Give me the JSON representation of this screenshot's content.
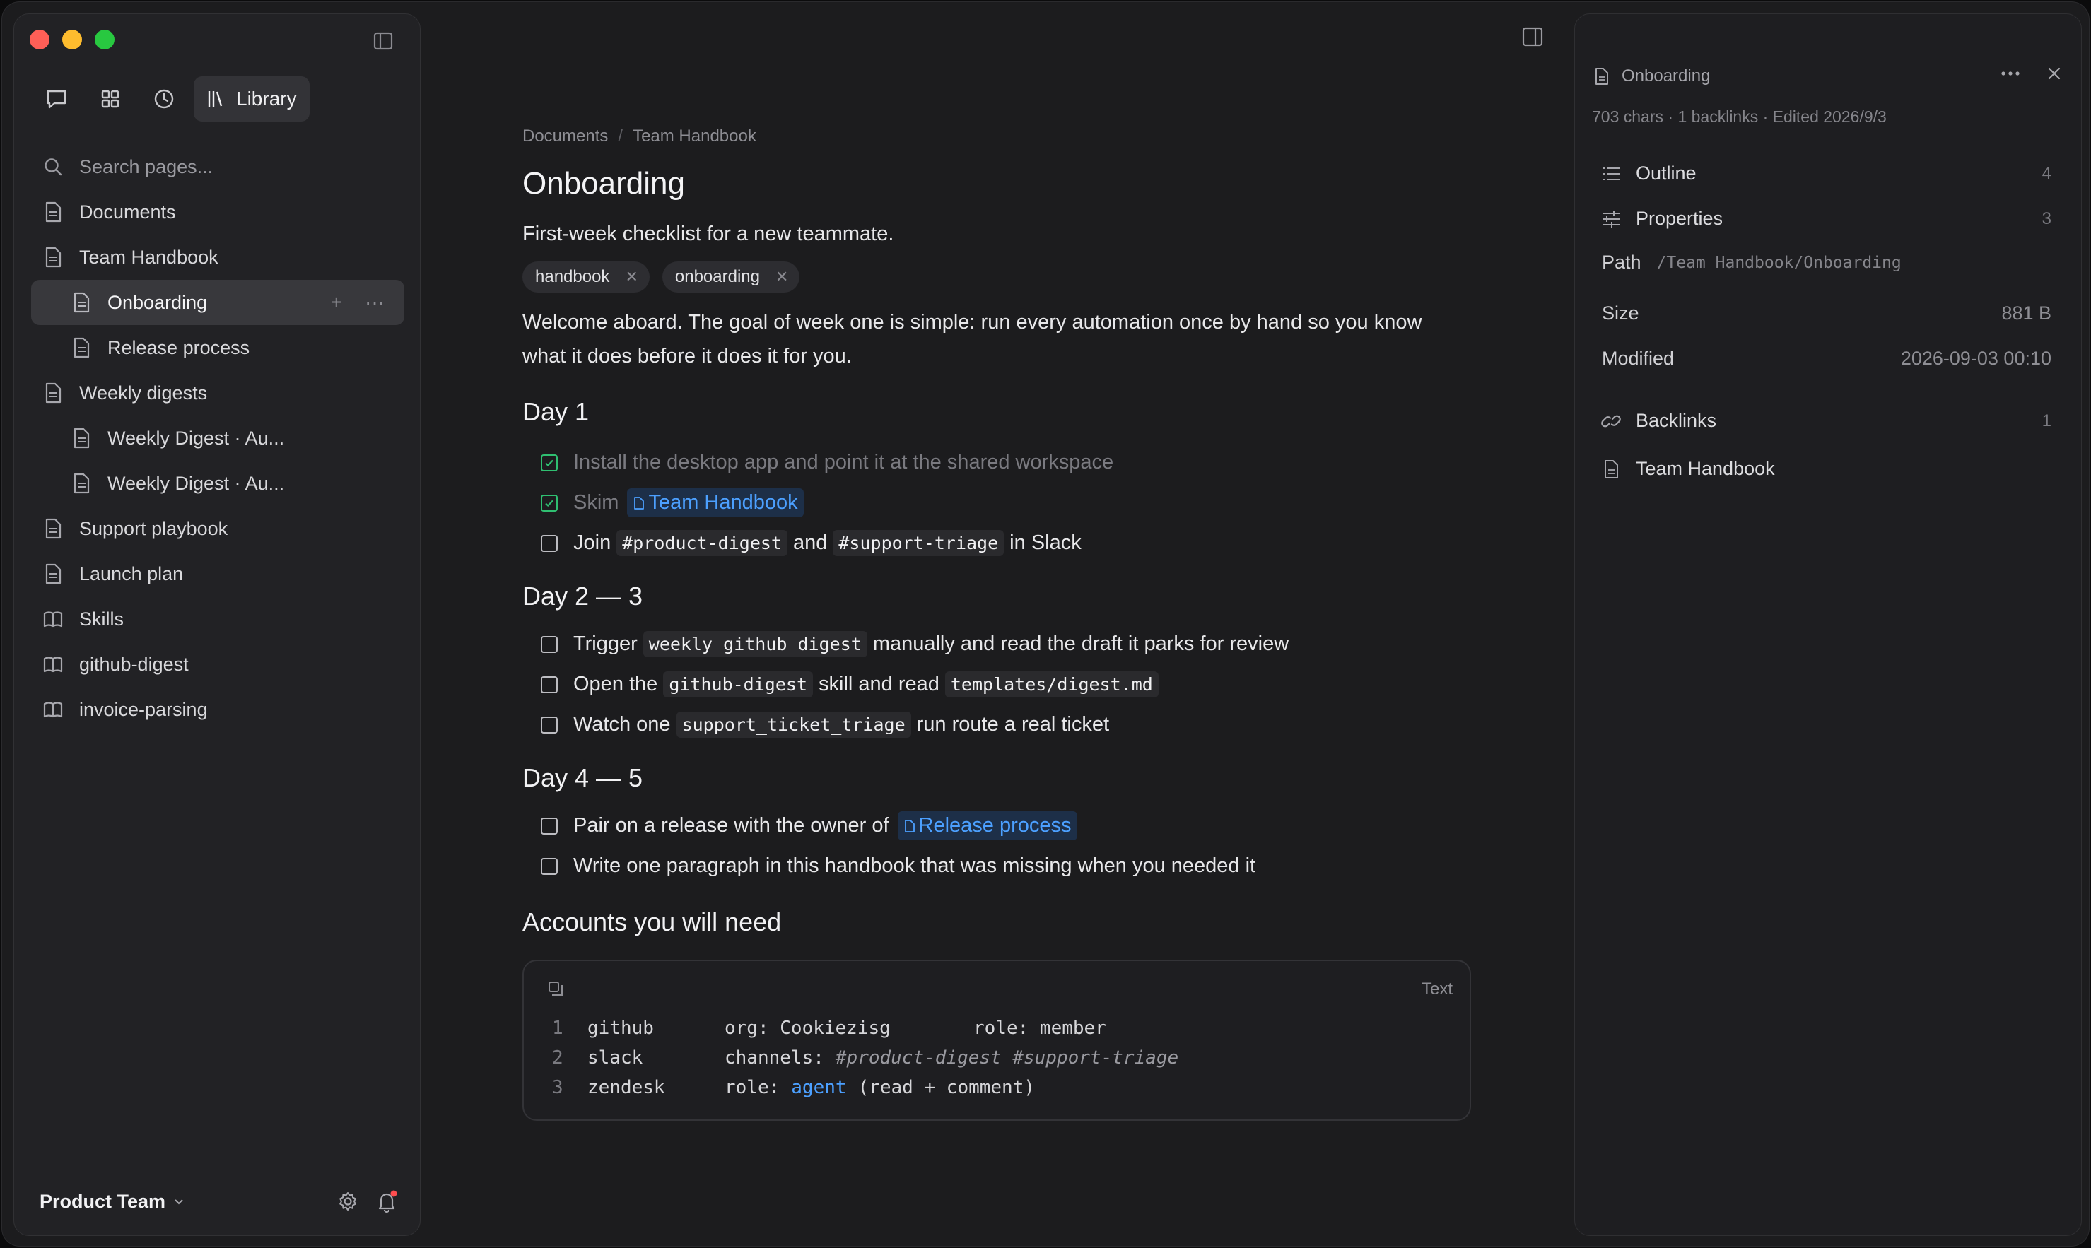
{
  "sidebar": {
    "library_label": "Library",
    "search_placeholder": "Search pages...",
    "items": [
      {
        "label": "Documents"
      },
      {
        "label": "Team Handbook"
      },
      {
        "label": "Onboarding"
      },
      {
        "label": "Release process"
      },
      {
        "label": "Weekly digests"
      },
      {
        "label": "Weekly Digest · Au..."
      },
      {
        "label": "Weekly Digest · Au..."
      },
      {
        "label": "Support playbook"
      },
      {
        "label": "Launch plan"
      },
      {
        "label": "Skills"
      },
      {
        "label": "github-digest"
      },
      {
        "label": "invoice-parsing"
      }
    ],
    "workspace": "Product Team",
    "row_actions": {
      "add": "+",
      "more": "···"
    }
  },
  "doc": {
    "breadcrumb": [
      "Documents",
      "/",
      "Team Handbook"
    ],
    "title": "Onboarding",
    "description": "First-week checklist for a new teammate.",
    "tags": [
      "handbook",
      "onboarding"
    ],
    "intro": "Welcome aboard. The goal of week one is simple: run every automation once by hand so you know what it does before it does it for you.",
    "day1": {
      "heading": "Day 1",
      "t1": "Install the desktop app and point it at the shared workspace",
      "t2_pre": "Skim",
      "t2_link": "Team Handbook",
      "t3_pre": "Join",
      "t3_code1": "#product-digest",
      "t3_mid": "and",
      "t3_code2": "#support-triage",
      "t3_post": "in Slack"
    },
    "day2": {
      "heading": "Day 2 — 3",
      "t1_pre": "Trigger",
      "t1_code": "weekly_github_digest",
      "t1_post": "manually and read the draft it parks for review",
      "t2_pre": "Open the",
      "t2_code1": "github-digest",
      "t2_mid": "skill and read",
      "t2_code2": "templates/digest.md",
      "t3_pre": "Watch one",
      "t3_code": "support_ticket_triage",
      "t3_post": "run route a real ticket"
    },
    "day4": {
      "heading": "Day 4 — 5",
      "t1_pre": "Pair on a release with the owner of",
      "t1_link": "Release process",
      "t2": "Write one paragraph in this handbook that was missing when you needed it"
    },
    "accounts": {
      "heading": "Accounts you will need",
      "lang": "Text",
      "lines": [
        {
          "n": "1",
          "a": "github",
          "b": "org: Cookiezisg",
          "c": "role: member"
        },
        {
          "n": "2",
          "a": "slack",
          "b": "channels:",
          "c": "#product-digest #support-triage"
        },
        {
          "n": "3",
          "a": "zendesk",
          "b": "role:",
          "c1": "agent",
          "c2": "(read + comment)"
        }
      ]
    }
  },
  "panel": {
    "title": "Onboarding",
    "meta": "703 chars · 1 backlinks · Edited 2026/9/3",
    "outline": {
      "label": "Outline",
      "count": "4"
    },
    "properties": {
      "label": "Properties",
      "count": "3"
    },
    "path_label": "Path",
    "path_value": "/Team Handbook/Onboarding",
    "size_label": "Size",
    "size_value": "881 B",
    "modified_label": "Modified",
    "modified_value": "2026-09-03 00:10",
    "backlinks": {
      "label": "Backlinks",
      "count": "1"
    },
    "backlink_item": "Team Handbook"
  },
  "colors": {
    "accent_link": "#4ca0ff",
    "check_done": "#2fbf71",
    "traffic_red": "#ff5f57",
    "traffic_yellow": "#febc2e",
    "traffic_green": "#28c840"
  }
}
